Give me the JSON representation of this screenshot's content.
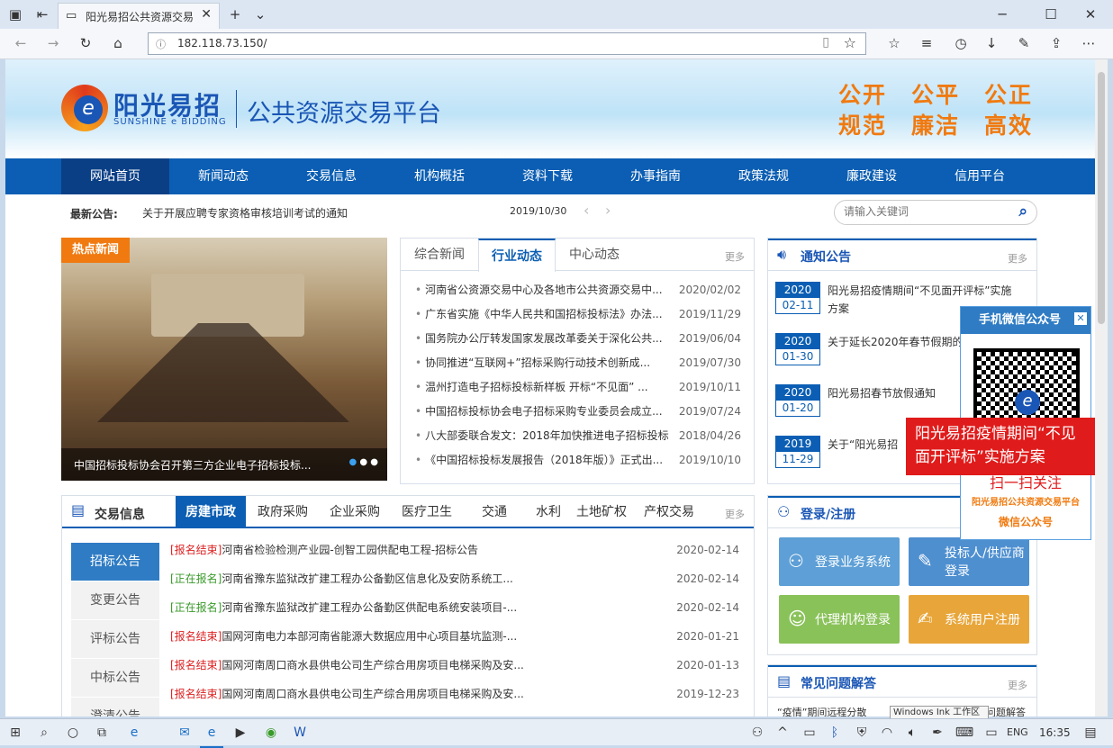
{
  "browser": {
    "tab_title": "阳光易招公共资源交易平",
    "url": "182.118.73.150/",
    "tooltip": "Windows Ink 工作区"
  },
  "header": {
    "brand_cn": "阳光易招",
    "brand_en": "SUNSHINE e BIDDING",
    "platform": "公共资源交易平台",
    "slogan1": "公开　公平　公正",
    "slogan2": "规范　廉洁　高效"
  },
  "nav": [
    "网站首页",
    "新闻动态",
    "交易信息",
    "机构概括",
    "资料下载",
    "办事指南",
    "政策法规",
    "廉政建设",
    "信用平台"
  ],
  "notice_bar": {
    "label": "最新公告:",
    "text": "关于开展应聘专家资格审核培训考试的通知",
    "date": "2019/10/30",
    "search_placeholder": "请输入关键词"
  },
  "hot": {
    "badge": "热点新闻",
    "caption": "中国招标投标协会召开第三方企业电子招标投标..."
  },
  "news": {
    "tabs": [
      "综合新闻",
      "行业动态",
      "中心动态"
    ],
    "more": "更多",
    "items": [
      {
        "t": "河南省公资源交易中心及各地市公共资源交易中...",
        "d": "2020/02/02"
      },
      {
        "t": "广东省实施《中华人民共和国招标投标法》办法...",
        "d": "2019/11/29"
      },
      {
        "t": "国务院办公厅转发国家发展改革委关于深化公共...",
        "d": "2019/06/04"
      },
      {
        "t": "协同推进“互联网+”招标采购行动技术创新成...",
        "d": "2019/07/30"
      },
      {
        "t": "温州打造电子招标投标新样板 开标“不见面” ...",
        "d": "2019/10/11"
      },
      {
        "t": "中国招标投标协会电子招标采购专业委员会成立...",
        "d": "2019/07/24"
      },
      {
        "t": "八大部委联合发文：2018年加快推进电子招标投标",
        "d": "2018/04/26"
      },
      {
        "t": "《中国招标投标发展报告（2018年版）》正式出...",
        "d": "2019/10/10"
      }
    ]
  },
  "announce": {
    "title": "通知公告",
    "more": "更多",
    "items": [
      {
        "y": "2020",
        "md": "02-11",
        "t": "阳光易招疫情期间“不见面开评标”实施方案"
      },
      {
        "y": "2020",
        "md": "01-30",
        "t": "关于延长2020年春节假期的"
      },
      {
        "y": "2020",
        "md": "01-20",
        "t": "阳光易招春节放假通知"
      },
      {
        "y": "2019",
        "md": "11-29",
        "t": "关于“阳光易招"
      }
    ]
  },
  "trade": {
    "title": "交易信息",
    "more": "更多",
    "tabs": [
      "房建市政",
      "政府采购",
      "企业采购",
      "医疗卫生",
      "交通",
      "水利",
      "土地矿权",
      "产权交易"
    ],
    "side": [
      "招标公告",
      "变更公告",
      "评标公告",
      "中标公告",
      "澄清公告"
    ],
    "rows": [
      {
        "tag": "[报名结束]",
        "type": 1,
        "t": "河南省检验检测产业园-创智工园供配电工程-招标公告",
        "d": "2020-02-14"
      },
      {
        "tag": "[正在报名]",
        "type": 2,
        "t": "河南省豫东监狱改扩建工程办公备勤区信息化及安防系统工...",
        "d": "2020-02-14"
      },
      {
        "tag": "[正在报名]",
        "type": 2,
        "t": "河南省豫东监狱改扩建工程办公备勤区供配电系统安装项目-...",
        "d": "2020-02-14"
      },
      {
        "tag": "[报名结束]",
        "type": 1,
        "t": "国网河南电力本部河南省能源大数据应用中心项目基坑监测-...",
        "d": "2020-01-21"
      },
      {
        "tag": "[报名结束]",
        "type": 1,
        "t": "国网河南周口商水县供电公司生产综合用房项目电梯采购及安...",
        "d": "2020-01-13"
      },
      {
        "tag": "[报名结束]",
        "type": 1,
        "t": "国网河南周口商水县供电公司生产综合用房项目电梯采购及安...",
        "d": "2019-12-23"
      }
    ]
  },
  "login": {
    "title": "登录/注册",
    "btns": [
      "登录业务系统",
      "投标人/供应商登录",
      "代理机构登录",
      "系统用户注册"
    ]
  },
  "faq": {
    "title": "常见问题解答",
    "more": "更多",
    "item": "“疫情”期间远程分散",
    "item_end": "问题解答"
  },
  "qr": {
    "title": "手机微信公众号",
    "scan": "扫一扫关注",
    "sub": "阳光易招公共资源交易平台",
    "sub2": "微信公众号"
  },
  "popup": "阳光易招疫情期间“不见面开评标”实施方案",
  "taskbar": {
    "lang": "ENG",
    "time": "16:35"
  }
}
